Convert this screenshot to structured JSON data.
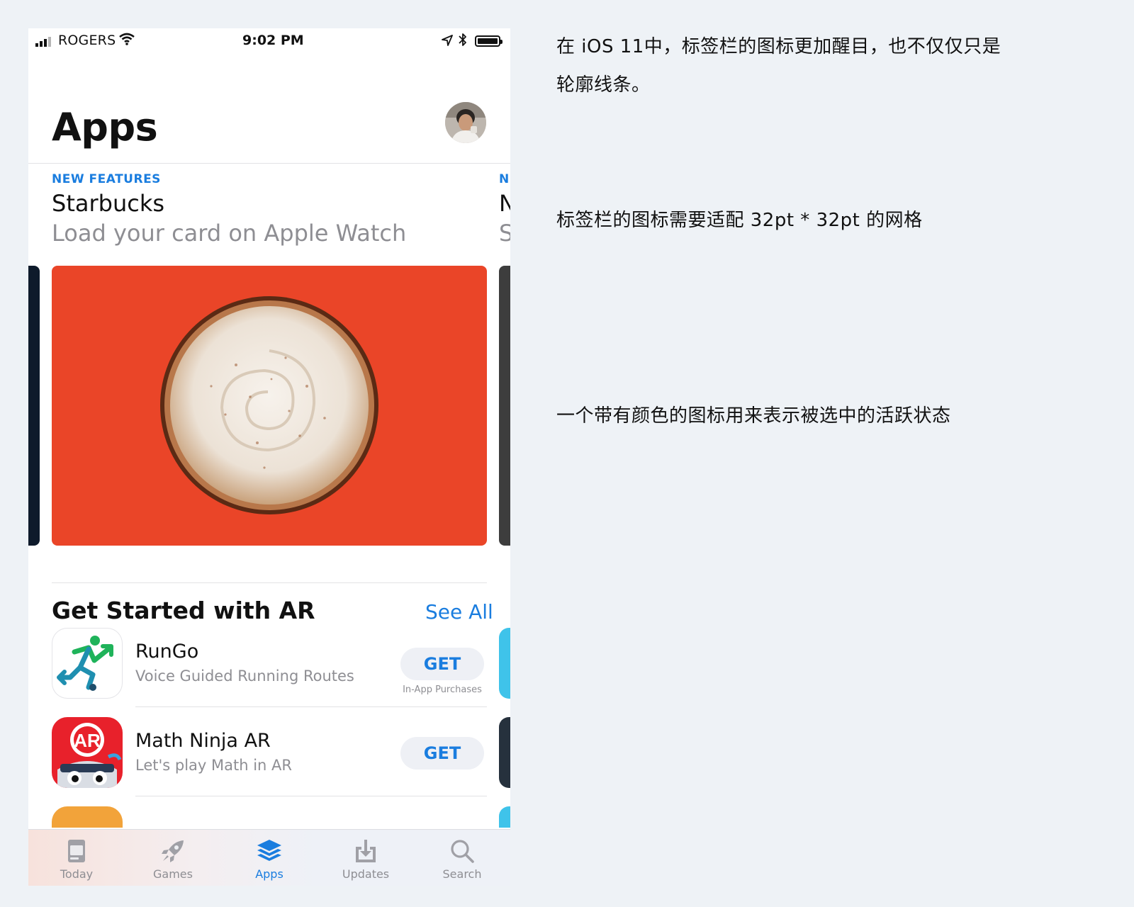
{
  "status_bar": {
    "carrier": "ROGERS",
    "time": "9:02 PM",
    "signal_bars": 4,
    "signal_active": 3,
    "battery_level": 1.0
  },
  "header": {
    "title": "Apps"
  },
  "featured": {
    "tag": "NEW FEATURES",
    "name": "Starbucks",
    "subtitle": "Load your card on Apple Watch",
    "peek_tag": "N",
    "peek_name": "N",
    "peek_subtitle": "S"
  },
  "section": {
    "title": "Get Started with AR",
    "see_all": "See All"
  },
  "apps": [
    {
      "name": "RunGo",
      "description": "Voice Guided Running Routes",
      "button": "GET",
      "note": "In-App Purchases"
    },
    {
      "name": "Math Ninja AR",
      "description": "Let's play Math in AR",
      "button": "GET",
      "note": ""
    }
  ],
  "tabs": [
    {
      "label": "Today",
      "icon": "today-icon"
    },
    {
      "label": "Games",
      "icon": "rocket-icon"
    },
    {
      "label": "Apps",
      "icon": "apps-stack-icon"
    },
    {
      "label": "Updates",
      "icon": "download-icon"
    },
    {
      "label": "Search",
      "icon": "search-icon"
    }
  ],
  "active_tab": "Apps",
  "colors": {
    "accent": "#1a7ddf",
    "card": "#ea4528",
    "inactive": "#8e8e93"
  },
  "notes": [
    {
      "line1": "在 iOS 11中，标签栏的图标更加醒目，也不仅仅只是",
      "line2": "轮廓线条。"
    },
    {
      "line1": "标签栏的图标需要适配 32pt * 32pt 的网格"
    },
    {
      "line1": "一个带有颜色的图标用来表示被选中的活跃状态"
    }
  ]
}
